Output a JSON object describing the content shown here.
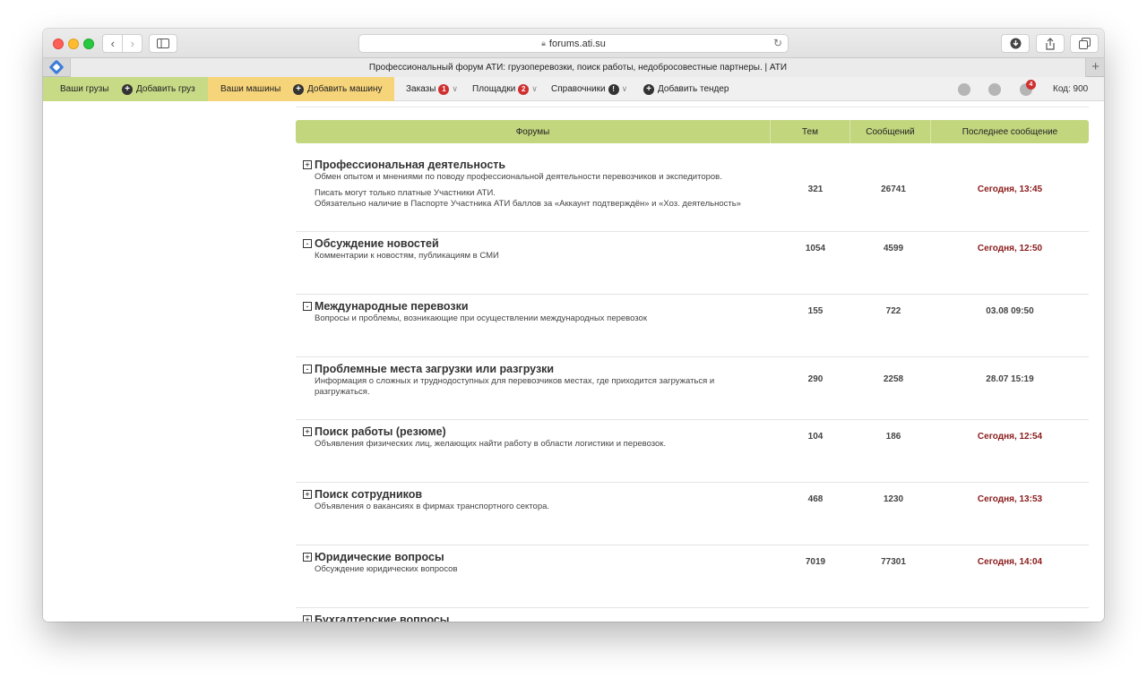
{
  "browser": {
    "url": "forums.ati.su",
    "tab_title": "Профессиональный форум АТИ: грузоперевозки, поиск работы, недобросовестные партнеры. | АТИ",
    "icons": [
      "back-icon",
      "forward-icon",
      "sidebar-icon",
      "lock-icon",
      "reload-icon",
      "download-icon",
      "share-icon",
      "tabs-icon",
      "new-tab-icon"
    ]
  },
  "nav": {
    "cargo": "Ваши грузы",
    "add_cargo": "Добавить груз",
    "trucks": "Ваши машины",
    "add_truck": "Добавить машину",
    "orders": "Заказы",
    "orders_badge": "1",
    "platforms": "Площадки",
    "platforms_badge": "2",
    "directories": "Справочники",
    "directories_badge": "!",
    "add_tender": "Добавить тендер",
    "notifications_badge": "4",
    "code": "Код: 900"
  },
  "table": {
    "headers": {
      "forums": "Форумы",
      "topics": "Тем",
      "posts": "Сообщений",
      "last_post": "Последнее сообщение"
    },
    "rows": [
      {
        "expand": "+",
        "title": "Профессиональная деятельность",
        "desc": "Обмен опытом и мнениями по поводу профессиональной деятельности перевозчиков и экспедиторов.",
        "note1": "Писать могут только платные Участники АТИ.",
        "note2": "Обязательно наличие в Паспорте Участника АТИ баллов за «Аккаунт подтверждён» и «Хоз. деятельность»",
        "topics": "321",
        "posts": "26741",
        "last": "Сегодня, 13:45"
      },
      {
        "expand": "-",
        "title": "Обсуждение новостей",
        "desc": "Комментарии к новостям, публикациям в СМИ",
        "topics": "1054",
        "posts": "4599",
        "last": "Сегодня, 12:50"
      },
      {
        "expand": "-",
        "title": "Международные перевозки",
        "desc": "Вопросы и проблемы, возникающие при осуществлении международных перевозок",
        "topics": "155",
        "posts": "722",
        "last": "03.08 09:50"
      },
      {
        "expand": "-",
        "title": "Проблемные места загрузки или разгрузки",
        "desc": "Информация о сложных и труднодоступных для перевозчиков местах, где приходится загружаться и разгружаться.",
        "topics": "290",
        "posts": "2258",
        "last": "28.07 15:19"
      },
      {
        "expand": "+",
        "title": "Поиск работы (резюме)",
        "desc": "Объявления физических лиц, желающих найти работу в области логистики и перевозок.",
        "topics": "104",
        "posts": "186",
        "last": "Сегодня, 12:54"
      },
      {
        "expand": "+",
        "title": "Поиск сотрудников",
        "desc": "Объявления о вакансиях в фирмах транспортного сектора.",
        "topics": "468",
        "posts": "1230",
        "last": "Сегодня, 13:53"
      },
      {
        "expand": "+",
        "title": "Юридические вопросы",
        "desc": "Обсуждение юридических вопросов",
        "topics": "7019",
        "posts": "77301",
        "last": "Сегодня, 14:04"
      },
      {
        "expand": "+",
        "title": "Бухгалтерские вопросы"
      }
    ]
  },
  "colors": {
    "header_green": "#c2d67e",
    "cargo_green": "#c7da86",
    "trucks_yellow": "#f6d47a",
    "recent_red": "#8b1b1b",
    "badge_red": "#d03030"
  }
}
